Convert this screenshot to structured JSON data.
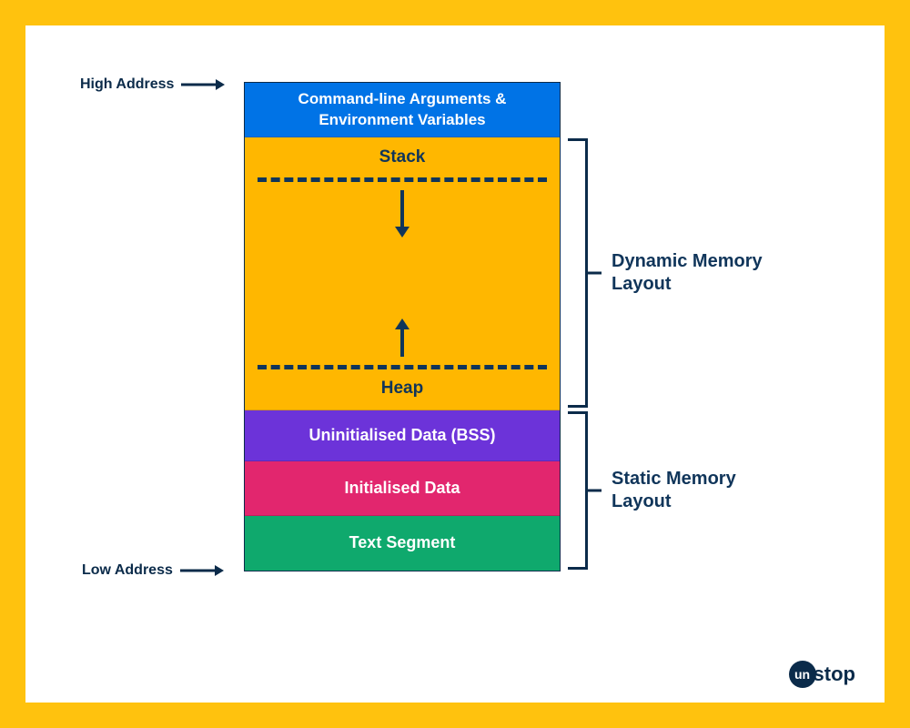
{
  "labels": {
    "high_address": "High Address",
    "low_address": "Low Address",
    "dynamic_group": "Dynamic Memory\nLayout",
    "static_group": "Static Memory\nLayout"
  },
  "segments": {
    "cmdline": "Command-line Arguments & Environment Variables",
    "stack": "Stack",
    "heap": "Heap",
    "bss": "Uninitialised Data (BSS)",
    "init": "Initialised Data",
    "text": "Text Segment"
  },
  "logo": {
    "circle": "un",
    "rest": "stop"
  },
  "colors": {
    "frame": "#ffc20e",
    "cmd": "#0073e6",
    "dynamic": "#ffb700",
    "bss": "#6c33d9",
    "init": "#e2266e",
    "text": "#0fa96d",
    "ink": "#10355a"
  }
}
